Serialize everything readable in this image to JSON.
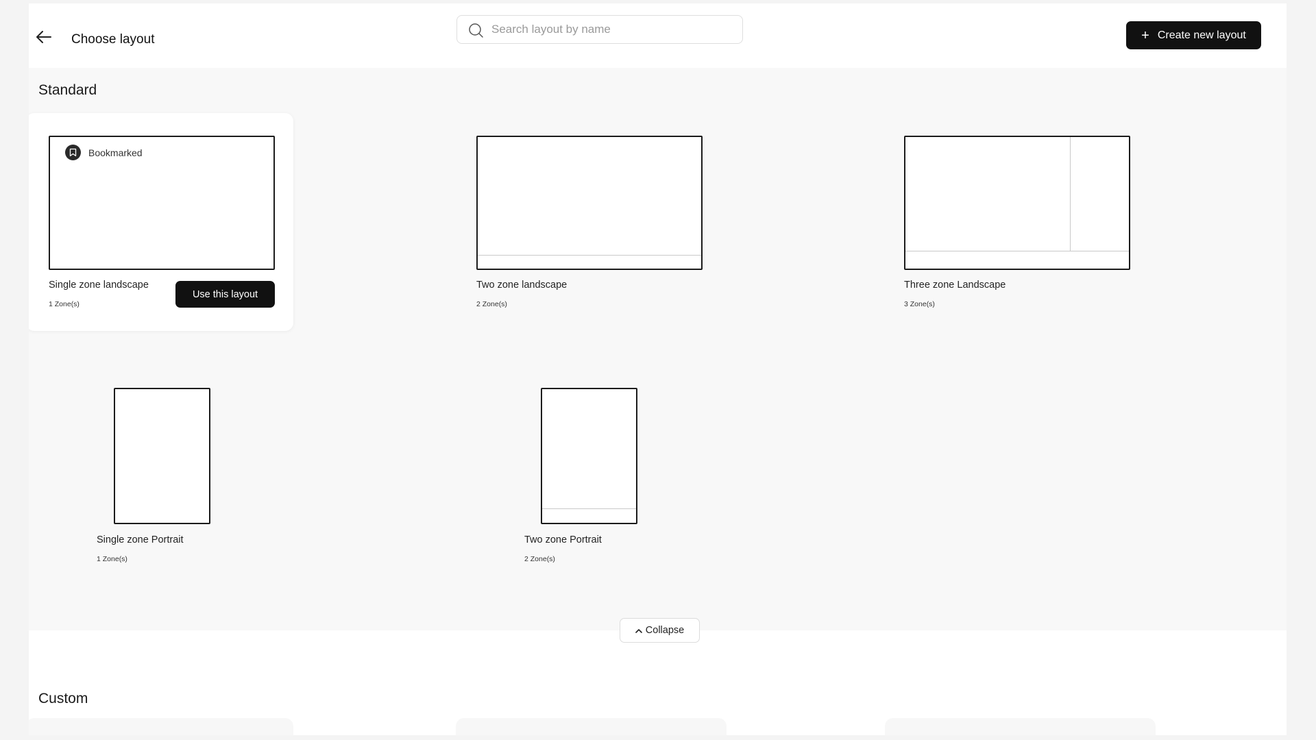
{
  "header": {
    "title": "Choose layout",
    "search_placeholder": "Search layout by name",
    "create_label": "Create new layout"
  },
  "sections": {
    "standard_title": "Standard",
    "custom_title": "Custom"
  },
  "layouts": [
    {
      "name": "Single zone landscape",
      "zones": "1 Zone(s)",
      "bookmark_label": "Bookmarked",
      "action_label": "Use this layout"
    },
    {
      "name": "Two zone landscape",
      "zones": "2 Zone(s)"
    },
    {
      "name": "Three zone Landscape",
      "zones": "3 Zone(s)"
    },
    {
      "name": "Single zone Portrait",
      "zones": "1 Zone(s)"
    },
    {
      "name": "Two zone Portrait",
      "zones": "2 Zone(s)"
    }
  ],
  "collapse_label": "Collapse",
  "icons": {
    "back": "arrow-left-icon",
    "search": "search-icon",
    "plus": "plus-icon",
    "bookmark": "bookmark-icon",
    "chevron": "chevron-up-icon"
  }
}
